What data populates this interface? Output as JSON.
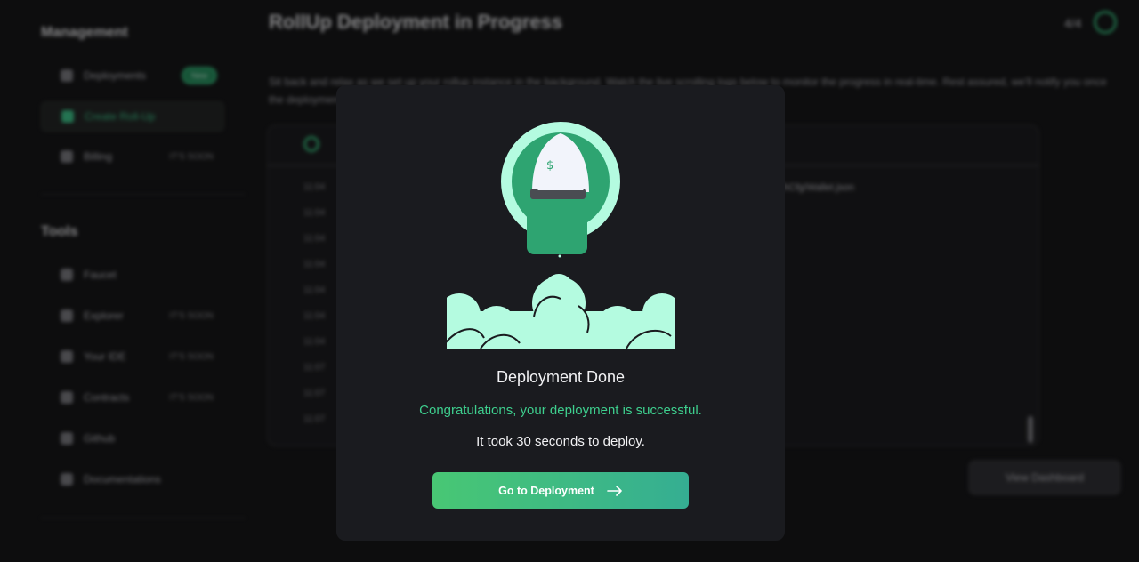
{
  "sidebar": {
    "management_heading": "Management",
    "tools_heading": "Tools",
    "items": [
      {
        "label": "Deployments",
        "badge": "New"
      },
      {
        "label": "Create Roll-Up"
      },
      {
        "label": "Billing",
        "tag": "IT'S SOON"
      },
      {
        "label": "Faucet"
      },
      {
        "label": "Explorer",
        "tag": "IT'S SOON"
      },
      {
        "label": "Your IDE",
        "tag": "IT'S SOON"
      },
      {
        "label": "Contracts",
        "tag": "IT'S SOON"
      },
      {
        "label": "Github"
      },
      {
        "label": "Documentations"
      }
    ]
  },
  "main": {
    "title": "RollUp Deployment in Progress",
    "step": "4/4",
    "description": "Sit back and relax as we set up your rollup instance in the background. Watch the live scrolling logs below to monitor the progress in real-time. Rest assured, we'll notify you once the deployment is complete.",
    "log_tail": "ethCfg/Wallet.json",
    "log_times": [
      "11:04",
      "11:04",
      "11:04",
      "11:04",
      "11:04",
      "11:04",
      "11:04",
      "11:07",
      "11:07",
      "11:07"
    ],
    "dashboard_button": "View Dashboard"
  },
  "modal": {
    "title": "Deployment Done",
    "subtitle": "Congratulations, your deployment is successful.",
    "time_text": "It took 30 seconds to deploy.",
    "button_label": "Go to Deployment"
  },
  "colors": {
    "accent": "#3ecf8e",
    "button_start": "#48c774",
    "button_end": "#35ae92",
    "modal_bg": "#1a1b1f",
    "illustration_green": "#2ea471",
    "illustration_mint": "#b4fbe0"
  },
  "icons": {
    "button_icon": "arrow-right-icon",
    "illustration": "rocket-launch-illustration"
  }
}
